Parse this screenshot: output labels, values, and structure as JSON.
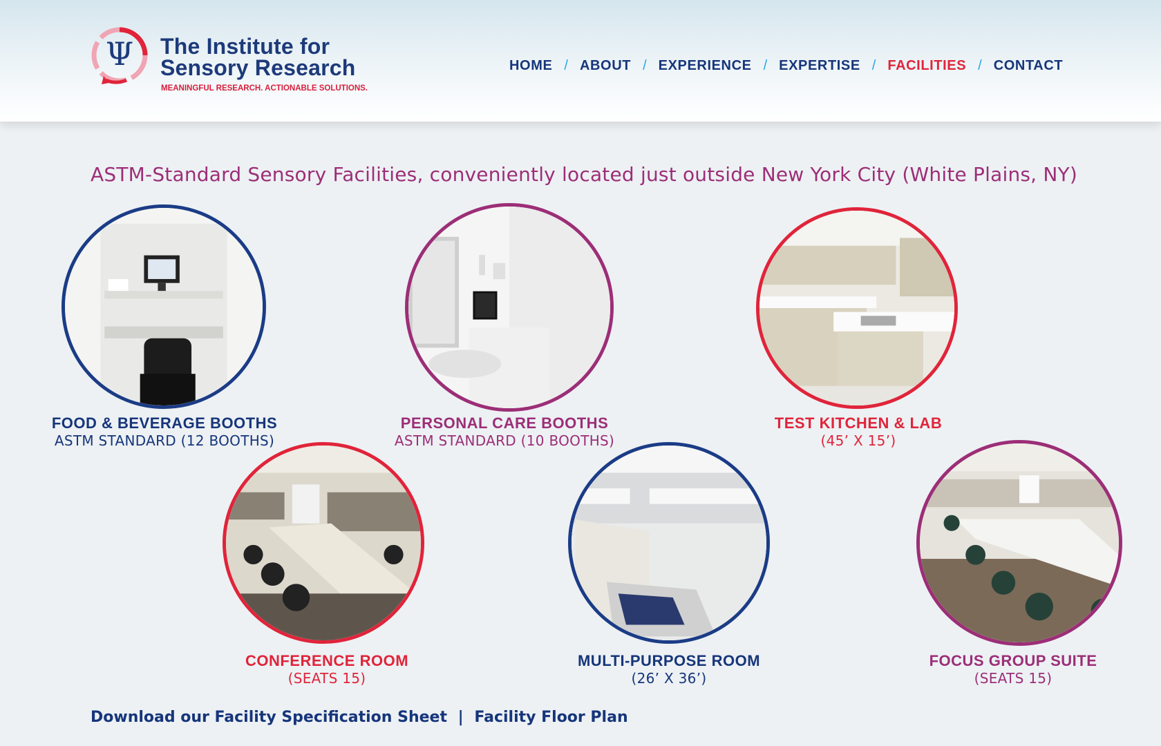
{
  "header": {
    "logo_title": "The Institute for Sensory Research",
    "logo_tagline": "MEANINGFUL RESEARCH. ACTIONABLE SOLUTIONS.",
    "nav": [
      {
        "label": "HOME"
      },
      {
        "label": "ABOUT"
      },
      {
        "label": "EXPERIENCE"
      },
      {
        "label": "EXPERTISE"
      },
      {
        "label": "FACILITIES",
        "active": true
      },
      {
        "label": "CONTACT"
      }
    ],
    "nav_separator": "/"
  },
  "headline": "ASTM-Standard Sensory Facilities, conveniently located just outside New York City (White Plains, NY)",
  "facilities": [
    {
      "title": "FOOD & BEVERAGE BOOTHS",
      "subtitle": "ASTM STANDARD (12 BOOTHS)",
      "ring_color": "#1b3c86"
    },
    {
      "title": "PERSONAL CARE BOOTHS",
      "subtitle": "ASTM STANDARD (10 BOOTHS)",
      "ring_color": "#9c2e77"
    },
    {
      "title": "TEST KITCHEN & LAB",
      "subtitle": "(45’ X 15’)",
      "ring_color": "#e0243a"
    },
    {
      "title": "CONFERENCE ROOM",
      "subtitle": "(SEATS 15)",
      "ring_color": "#e0243a"
    },
    {
      "title": "MULTI-PURPOSE ROOM",
      "subtitle": "(26’ X 36’)",
      "ring_color": "#1b3c86"
    },
    {
      "title": "FOCUS GROUP SUITE",
      "subtitle": "(SEATS 15)",
      "ring_color": "#9c2e77"
    }
  ],
  "downloads": {
    "spec_sheet": "Download our Facility Specification Sheet",
    "separator": "|",
    "floor_plan": "Facility Floor Plan"
  },
  "colors": {
    "blue": "#16357a",
    "purple": "#9c2e77",
    "red": "#e0243a",
    "separator": "#29a8e0"
  }
}
